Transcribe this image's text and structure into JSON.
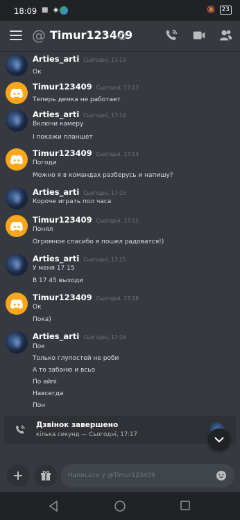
{
  "status_bar": {
    "time": "18:09",
    "battery": "23"
  },
  "header": {
    "channel": "Timur123409"
  },
  "messages": [
    {
      "author": "Arties_arti",
      "time": "Сьогодні, 17:12",
      "avatar": "arties",
      "lines": [
        "Ок"
      ]
    },
    {
      "author": "Timur123409",
      "time": "Сьогодні, 17:13",
      "avatar": "discord",
      "lines": [
        "Теперь демка не работает"
      ]
    },
    {
      "author": "Arties_arti",
      "time": "Сьогодні, 17:14",
      "avatar": "arties",
      "lines": [
        "Включи камеру",
        "І покажи планшет"
      ]
    },
    {
      "author": "Timur123409",
      "time": "Сьогодні, 17:14",
      "avatar": "discord",
      "lines": [
        "Погоди",
        "Можно я в командах разберусь и напишу?"
      ]
    },
    {
      "author": "Arties_arti",
      "time": "Сьогодні, 17:15",
      "avatar": "arties",
      "lines": [
        "Короче играть пол часа"
      ]
    },
    {
      "author": "Timur123409",
      "time": "Сьогодні, 17:15",
      "avatar": "discord",
      "lines": [
        "Понял",
        "Огромное спасибо я пошел радоватся!)"
      ]
    },
    {
      "author": "Arties_arti",
      "time": "Сьогодні, 17:15",
      "avatar": "arties",
      "lines": [
        "У меня 17 15",
        "В 17 45 выходи"
      ]
    },
    {
      "author": "Timur123409",
      "time": "Сьогодні, 17:16",
      "avatar": "discord",
      "lines": [
        "Ок",
        "Пока)"
      ]
    },
    {
      "author": "Arties_arti",
      "time": "Сьогодні, 17:16",
      "avatar": "arties",
      "lines": [
        "Пок",
        "Только глупостей не роби",
        "А то забаню и всьо",
        "По айпі",
        "Навсегда",
        "Пон"
      ]
    }
  ],
  "call": {
    "title": "Дзвінок завершено",
    "subtitle": "кілька секунд — Сьогодні, 17:17"
  },
  "composer": {
    "placeholder": "Написати у @Timur123409"
  },
  "icons": {
    "menu": "hamburger-icon",
    "call": "phone-call-icon",
    "video": "video-camera-icon",
    "members": "members-icon",
    "add": "plus-icon",
    "gift": "gift-icon",
    "emoji": "emoji-icon",
    "scroll": "chevron-down-icon"
  },
  "colors": {
    "bg": "#36393f",
    "discord_avatar": "#faa61a",
    "header": "#202225"
  }
}
